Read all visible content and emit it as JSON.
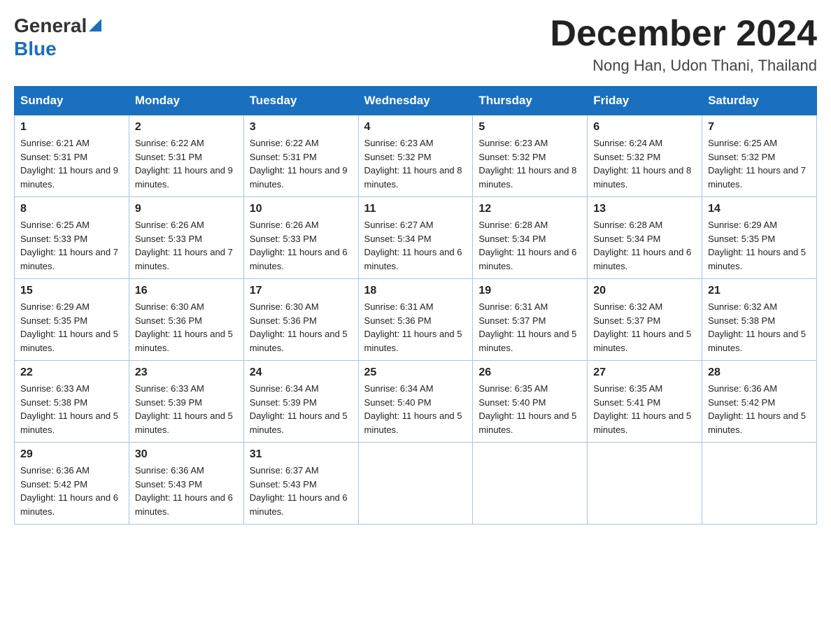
{
  "header": {
    "logo_general": "General",
    "logo_blue": "Blue",
    "month_title": "December 2024",
    "location": "Nong Han, Udon Thani, Thailand"
  },
  "weekdays": [
    "Sunday",
    "Monday",
    "Tuesday",
    "Wednesday",
    "Thursday",
    "Friday",
    "Saturday"
  ],
  "weeks": [
    [
      {
        "day": "1",
        "sunrise": "6:21 AM",
        "sunset": "5:31 PM",
        "daylight": "11 hours and 9 minutes."
      },
      {
        "day": "2",
        "sunrise": "6:22 AM",
        "sunset": "5:31 PM",
        "daylight": "11 hours and 9 minutes."
      },
      {
        "day": "3",
        "sunrise": "6:22 AM",
        "sunset": "5:31 PM",
        "daylight": "11 hours and 9 minutes."
      },
      {
        "day": "4",
        "sunrise": "6:23 AM",
        "sunset": "5:32 PM",
        "daylight": "11 hours and 8 minutes."
      },
      {
        "day": "5",
        "sunrise": "6:23 AM",
        "sunset": "5:32 PM",
        "daylight": "11 hours and 8 minutes."
      },
      {
        "day": "6",
        "sunrise": "6:24 AM",
        "sunset": "5:32 PM",
        "daylight": "11 hours and 8 minutes."
      },
      {
        "day": "7",
        "sunrise": "6:25 AM",
        "sunset": "5:32 PM",
        "daylight": "11 hours and 7 minutes."
      }
    ],
    [
      {
        "day": "8",
        "sunrise": "6:25 AM",
        "sunset": "5:33 PM",
        "daylight": "11 hours and 7 minutes."
      },
      {
        "day": "9",
        "sunrise": "6:26 AM",
        "sunset": "5:33 PM",
        "daylight": "11 hours and 7 minutes."
      },
      {
        "day": "10",
        "sunrise": "6:26 AM",
        "sunset": "5:33 PM",
        "daylight": "11 hours and 6 minutes."
      },
      {
        "day": "11",
        "sunrise": "6:27 AM",
        "sunset": "5:34 PM",
        "daylight": "11 hours and 6 minutes."
      },
      {
        "day": "12",
        "sunrise": "6:28 AM",
        "sunset": "5:34 PM",
        "daylight": "11 hours and 6 minutes."
      },
      {
        "day": "13",
        "sunrise": "6:28 AM",
        "sunset": "5:34 PM",
        "daylight": "11 hours and 6 minutes."
      },
      {
        "day": "14",
        "sunrise": "6:29 AM",
        "sunset": "5:35 PM",
        "daylight": "11 hours and 5 minutes."
      }
    ],
    [
      {
        "day": "15",
        "sunrise": "6:29 AM",
        "sunset": "5:35 PM",
        "daylight": "11 hours and 5 minutes."
      },
      {
        "day": "16",
        "sunrise": "6:30 AM",
        "sunset": "5:36 PM",
        "daylight": "11 hours and 5 minutes."
      },
      {
        "day": "17",
        "sunrise": "6:30 AM",
        "sunset": "5:36 PM",
        "daylight": "11 hours and 5 minutes."
      },
      {
        "day": "18",
        "sunrise": "6:31 AM",
        "sunset": "5:36 PM",
        "daylight": "11 hours and 5 minutes."
      },
      {
        "day": "19",
        "sunrise": "6:31 AM",
        "sunset": "5:37 PM",
        "daylight": "11 hours and 5 minutes."
      },
      {
        "day": "20",
        "sunrise": "6:32 AM",
        "sunset": "5:37 PM",
        "daylight": "11 hours and 5 minutes."
      },
      {
        "day": "21",
        "sunrise": "6:32 AM",
        "sunset": "5:38 PM",
        "daylight": "11 hours and 5 minutes."
      }
    ],
    [
      {
        "day": "22",
        "sunrise": "6:33 AM",
        "sunset": "5:38 PM",
        "daylight": "11 hours and 5 minutes."
      },
      {
        "day": "23",
        "sunrise": "6:33 AM",
        "sunset": "5:39 PM",
        "daylight": "11 hours and 5 minutes."
      },
      {
        "day": "24",
        "sunrise": "6:34 AM",
        "sunset": "5:39 PM",
        "daylight": "11 hours and 5 minutes."
      },
      {
        "day": "25",
        "sunrise": "6:34 AM",
        "sunset": "5:40 PM",
        "daylight": "11 hours and 5 minutes."
      },
      {
        "day": "26",
        "sunrise": "6:35 AM",
        "sunset": "5:40 PM",
        "daylight": "11 hours and 5 minutes."
      },
      {
        "day": "27",
        "sunrise": "6:35 AM",
        "sunset": "5:41 PM",
        "daylight": "11 hours and 5 minutes."
      },
      {
        "day": "28",
        "sunrise": "6:36 AM",
        "sunset": "5:42 PM",
        "daylight": "11 hours and 5 minutes."
      }
    ],
    [
      {
        "day": "29",
        "sunrise": "6:36 AM",
        "sunset": "5:42 PM",
        "daylight": "11 hours and 6 minutes."
      },
      {
        "day": "30",
        "sunrise": "6:36 AM",
        "sunset": "5:43 PM",
        "daylight": "11 hours and 6 minutes."
      },
      {
        "day": "31",
        "sunrise": "6:37 AM",
        "sunset": "5:43 PM",
        "daylight": "11 hours and 6 minutes."
      },
      null,
      null,
      null,
      null
    ]
  ]
}
